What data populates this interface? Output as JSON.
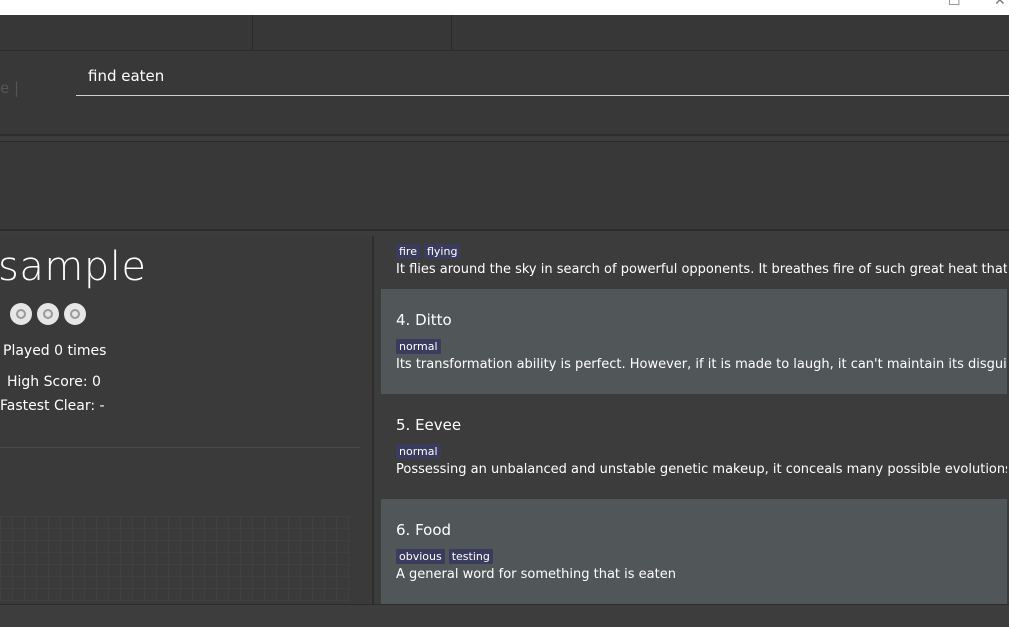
{
  "window": {
    "maximize_glyph": "☐",
    "close_glyph": "✕"
  },
  "command": {
    "prompt_hint": "e |",
    "value": "find eaten"
  },
  "deck": {
    "title": "sample",
    "played": "Played 0 times",
    "high_score": "High Score: 0",
    "fastest_clear": "Fastest Clear:  -",
    "badges": [
      "grass-type-icon",
      "water-type-icon",
      "fire-type-icon"
    ]
  },
  "cards": [
    {
      "title": "",
      "tags": [
        "fire",
        "flying"
      ],
      "description": "It flies around the sky in search of powerful opponents. It breathes fire of such great heat that it ..."
    },
    {
      "title": "4.  Ditto",
      "tags": [
        "normal"
      ],
      "description": "Its transformation ability is perfect. However, if it is made to laugh, it can't maintain its disguise."
    },
    {
      "title": "5.  Eevee",
      "tags": [
        "normal"
      ],
      "description": "Possessing an unbalanced and unstable genetic makeup, it conceals many possible evolutions."
    },
    {
      "title": "6.  Food",
      "tags": [
        "obvious",
        "testing"
      ],
      "description": "A general word for something that is eaten"
    }
  ]
}
